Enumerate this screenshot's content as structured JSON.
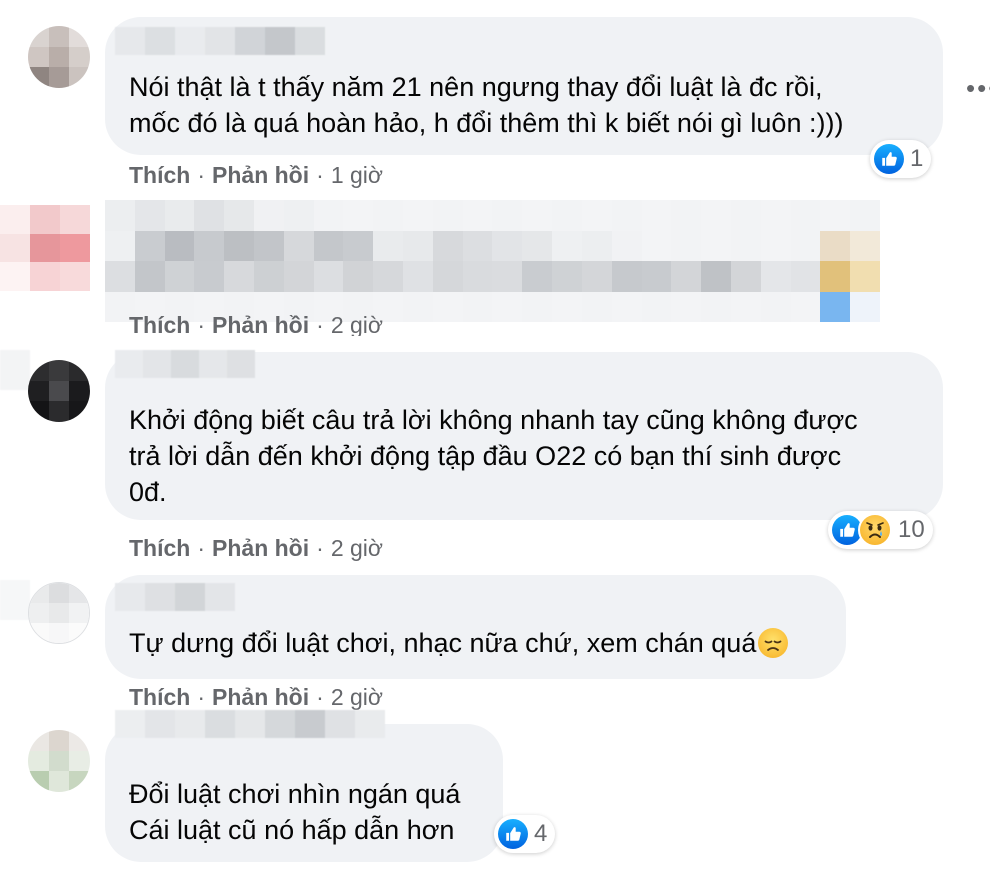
{
  "colors": {
    "bubble": "#f0f2f5",
    "meta_text": "#65676b",
    "like_blue": "#1877f2"
  },
  "actions": {
    "like": "Thích",
    "reply": "Phản hồi",
    "separator": "·"
  },
  "more_icon": "more-options-icon",
  "comments": [
    {
      "text": "Nói thật là t thấy năm 21 nên ngưng thay đổi luật là đc rồi,\nmốc đó là quá hoàn hảo, h đổi thêm thì k biết nói gì luôn :)))",
      "time": "1 giờ",
      "reactions": [
        "like-icon"
      ],
      "reaction_count": "1"
    },
    {
      "text": "",
      "time": "2 giờ",
      "reactions": [],
      "reaction_count": ""
    },
    {
      "text": "Khởi động biết câu trả lời không nhanh tay cũng không được\ntrả lời dẫn đến khởi động tập đầu O22 có bạn thí sinh được\n0đ.",
      "time": "2 giờ",
      "reactions": [
        "like-icon",
        "sad-icon"
      ],
      "reaction_count": "10"
    },
    {
      "text": "Tự dưng đổi luật chơi, nhạc nữa chứ, xem chán quá",
      "emoji": "disappointed-face-emoji",
      "time": "2 giờ",
      "reactions": [],
      "reaction_count": ""
    },
    {
      "text": "Đổi luật chơi nhìn ngán quá\nCái luật cũ nó hấp dẫn hơn",
      "time": "",
      "reactions": [
        "like-icon"
      ],
      "reaction_count": "4"
    }
  ]
}
